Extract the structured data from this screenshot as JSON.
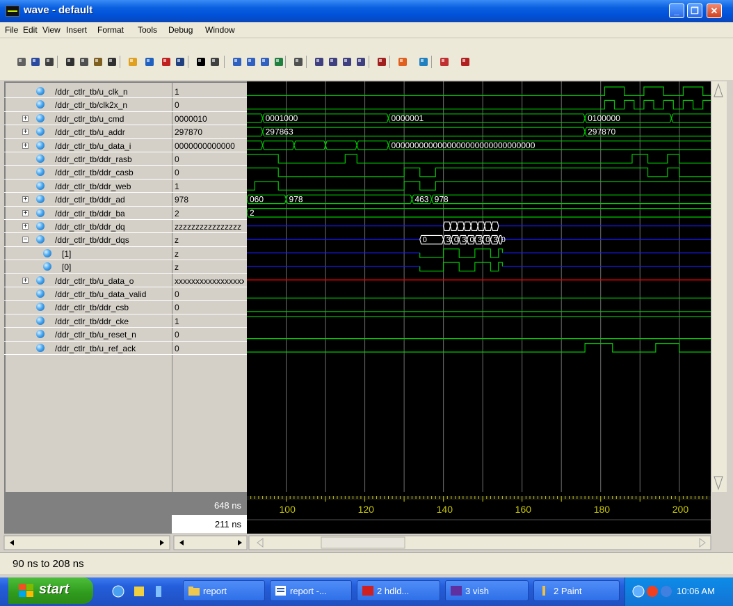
{
  "window": {
    "title": "wave - default"
  },
  "menu": [
    "File",
    "Edit",
    "View",
    "Insert",
    "Format",
    "Tools",
    "Debug",
    "Window"
  ],
  "toolbar": [
    "open-icon",
    "save-icon",
    "print-icon",
    "cut-icon",
    "copy-icon",
    "paste-icon",
    "find-icon",
    "select-mode-icon",
    "delete-icon",
    "insert-cursor-icon",
    "delete-cursor-icon",
    "select-pointer-icon",
    "zoom-box-icon",
    "zoom-in-icon",
    "zoom-out-icon",
    "zoom-full-icon",
    "zoom-fit-icon",
    "add-signal-icon",
    "find-prev-edge-icon",
    "find-next-edge-icon",
    "find-fall-icon",
    "find-rise-icon",
    "clear-icon",
    "run-icon",
    "restart-icon",
    "step-icon",
    "break-icon"
  ],
  "signals": [
    {
      "name": "/ddr_ctlr_tb/u_clk_n",
      "value": "1",
      "expandable": false
    },
    {
      "name": "/ddr_ctlr_tb/clk2x_n",
      "value": "0",
      "expandable": false
    },
    {
      "name": "/ddr_ctlr_tb/u_cmd",
      "value": "0000010",
      "expandable": true
    },
    {
      "name": "/ddr_ctlr_tb/u_addr",
      "value": "297870",
      "expandable": true
    },
    {
      "name": "/ddr_ctlr_tb/u_data_i",
      "value": "0000000000000",
      "expandable": true
    },
    {
      "name": "/ddr_ctlr_tb/ddr_rasb",
      "value": "0",
      "expandable": false
    },
    {
      "name": "/ddr_ctlr_tb/ddr_casb",
      "value": "0",
      "expandable": false
    },
    {
      "name": "/ddr_ctlr_tb/ddr_web",
      "value": "1",
      "expandable": false
    },
    {
      "name": "/ddr_ctlr_tb/ddr_ad",
      "value": "978",
      "expandable": true
    },
    {
      "name": "/ddr_ctlr_tb/ddr_ba",
      "value": "2",
      "expandable": true
    },
    {
      "name": "/ddr_ctlr_tb/ddr_dq",
      "value": "zzzzzzzzzzzzzzzz",
      "expandable": true
    },
    {
      "name": "/ddr_ctlr_tb/ddr_dqs",
      "value": "z",
      "expandable": true,
      "expanded": true
    },
    {
      "name": "[1]",
      "value": "z",
      "sub": true
    },
    {
      "name": "[0]",
      "value": "z",
      "sub": true
    },
    {
      "name": "/ddr_ctlr_tb/u_data_o",
      "value": "xxxxxxxxxxxxxxxxx",
      "expandable": true
    },
    {
      "name": "/ddr_ctlr_tb/u_data_valid",
      "value": "0",
      "expandable": false
    },
    {
      "name": "/ddr_ctlr_tb/ddr_csb",
      "value": "0",
      "expandable": false
    },
    {
      "name": "/ddr_ctlr_tb/ddr_cke",
      "value": "1",
      "expandable": false
    },
    {
      "name": "/ddr_ctlr_tb/u_reset_n",
      "value": "0",
      "expandable": false
    },
    {
      "name": "/ddr_ctlr_tb/u_ref_ack",
      "value": "0",
      "expandable": false
    }
  ],
  "bus_labels": {
    "cmd": [
      "0001000",
      "0000001",
      "0100000"
    ],
    "addr": [
      "297863",
      "297870"
    ],
    "data_i": "0000000000000000000000000000000",
    "ad": [
      "060",
      "978",
      "463",
      "978"
    ],
    "ba": "2",
    "dqs": [
      "0",
      "3",
      "0",
      "3",
      "0",
      "3",
      "0",
      "3",
      "0"
    ]
  },
  "cursors": {
    "now": "648 ns",
    "cursor1": "211 ns"
  },
  "timeline": {
    "ticks": [
      "100",
      "120",
      "140",
      "160",
      "180",
      "200"
    ]
  },
  "status": {
    "range": "90 ns to 208 ns"
  },
  "colors": {
    "wave": "#00c800",
    "highz": "#1a1aff",
    "unknown": "#e00000",
    "grid": "#707070"
  },
  "taskbar": {
    "start": "start",
    "tasks": [
      {
        "label": "report",
        "icon": "folder-icon"
      },
      {
        "label": "report -...",
        "icon": "word-icon"
      },
      {
        "label": "2 hdld...",
        "icon": "hdl-icon"
      },
      {
        "label": "3 vish",
        "icon": "vsim-icon"
      },
      {
        "label": "2 Paint",
        "icon": "paint-icon"
      }
    ],
    "clock": "10:06 AM"
  }
}
